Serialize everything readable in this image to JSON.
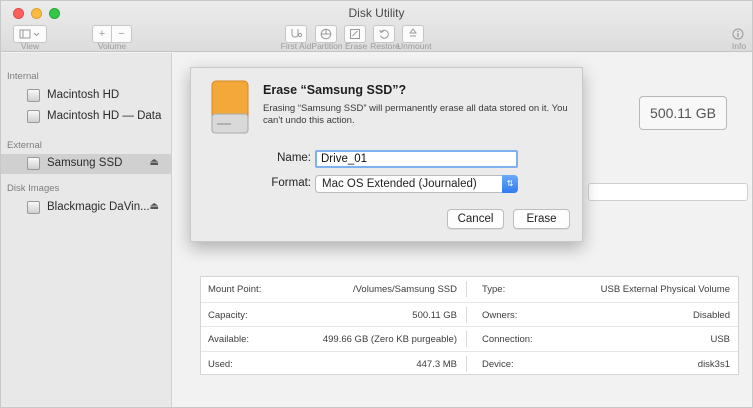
{
  "window": {
    "title": "Disk Utility"
  },
  "toolbar": {
    "view_label": "View",
    "volume_label": "Volume",
    "add_symbol": "+",
    "remove_symbol": "−",
    "first_aid_label": "First Aid",
    "partition_label": "Partition",
    "erase_label": "Erase",
    "restore_label": "Restore",
    "unmount_label": "Unmount",
    "info_label": "Info"
  },
  "sidebar": {
    "internal_header": "Internal",
    "internal_items": [
      {
        "label": "Macintosh HD"
      },
      {
        "label": "Macintosh HD — Data"
      }
    ],
    "external_header": "External",
    "external_items": [
      {
        "label": "Samsung SSD",
        "eject": "⏏"
      }
    ],
    "images_header": "Disk Images",
    "image_items": [
      {
        "label": "Blackmagic DaVin...",
        "eject": "⏏"
      }
    ]
  },
  "main": {
    "capacity_display": "500.11 GB"
  },
  "info_table": {
    "rows": [
      {
        "left_label": "Mount Point:",
        "left_value": "/Volumes/Samsung SSD",
        "right_label": "Type:",
        "right_value": "USB External Physical Volume"
      },
      {
        "left_label": "Capacity:",
        "left_value": "500.11 GB",
        "right_label": "Owners:",
        "right_value": "Disabled"
      },
      {
        "left_label": "Available:",
        "left_value": "499.66 GB (Zero KB purgeable)",
        "right_label": "Connection:",
        "right_value": "USB"
      },
      {
        "left_label": "Used:",
        "left_value": "447.3 MB",
        "right_label": "Device:",
        "right_value": "disk3s1"
      }
    ]
  },
  "dialog": {
    "title": "Erase “Samsung SSD”?",
    "message": "Erasing “Samsung SSD” will permanently erase all data stored on it. You can't undo this action.",
    "name_label": "Name:",
    "name_value": "Drive_01",
    "format_label": "Format:",
    "format_value": "Mac OS Extended (Journaled)",
    "cancel_label": "Cancel",
    "erase_label": "Erase"
  },
  "colors": {
    "accent": "#2f7cf0",
    "disk_orange": "#f4a83a",
    "selection": "#d0d0d0"
  }
}
